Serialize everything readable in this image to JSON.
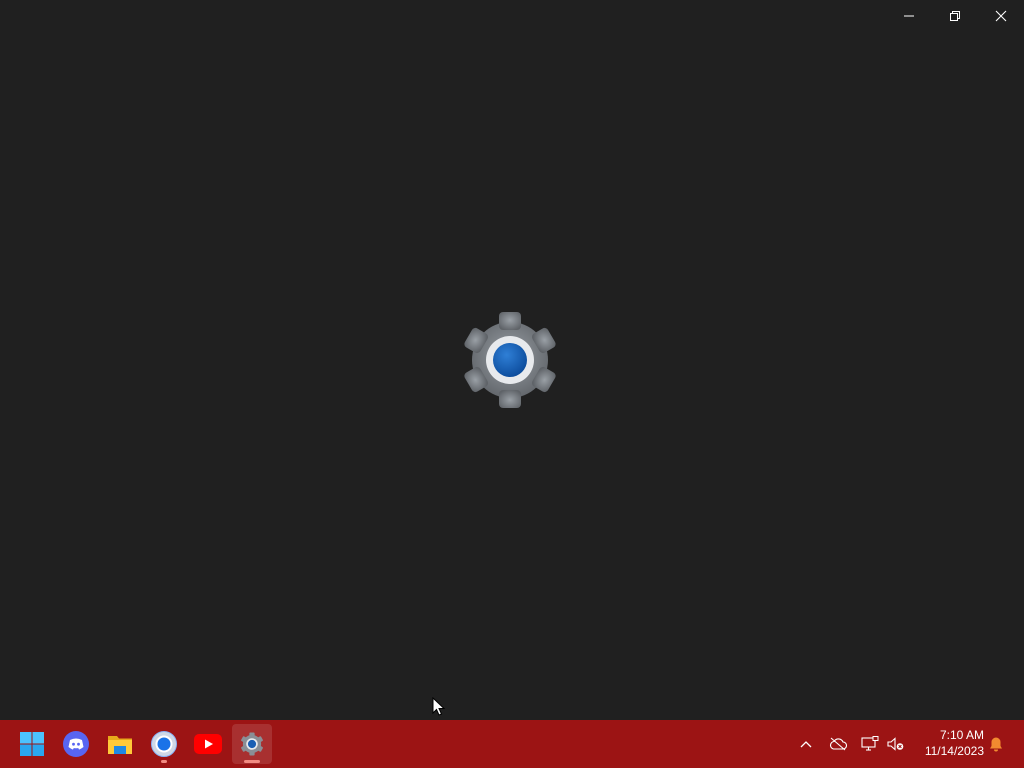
{
  "window": {
    "background": "#202020",
    "caption_buttons": [
      "minimize",
      "restore",
      "close"
    ]
  },
  "splash": {
    "icon": "settings-gear-icon"
  },
  "taskbar": {
    "background": "#9c1414",
    "apps": [
      {
        "name": "start",
        "icon": "windows-logo-icon"
      },
      {
        "name": "discord",
        "icon": "discord-icon"
      },
      {
        "name": "file-explorer",
        "icon": "folder-icon"
      },
      {
        "name": "chrome",
        "icon": "chrome-icon",
        "running": true
      },
      {
        "name": "youtube",
        "icon": "youtube-icon"
      },
      {
        "name": "settings",
        "icon": "settings-gear-icon",
        "active": true
      }
    ],
    "tray": {
      "icons": [
        "chevron-up-icon",
        "cloud-off-icon",
        "network-icon",
        "volume-muted-icon",
        "notification-bell-icon"
      ]
    },
    "clock": {
      "time": "7:10 AM",
      "date": "11/14/2023"
    }
  }
}
